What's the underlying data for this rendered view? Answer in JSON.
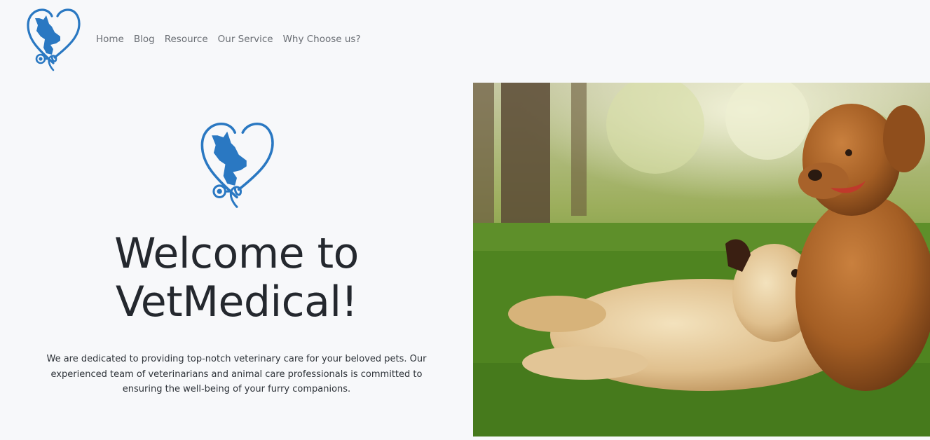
{
  "nav": {
    "logo_icon": "vet-heart-stethoscope-logo",
    "links": [
      {
        "label": "Home"
      },
      {
        "label": "Blog"
      },
      {
        "label": "Resource"
      },
      {
        "label": "Our Service"
      },
      {
        "label": "Why Choose us?"
      }
    ]
  },
  "hero": {
    "logo_icon": "vet-heart-stethoscope-logo",
    "title_line1": "Welcome to",
    "title_line2": "VetMedical!",
    "description": "We are dedicated to providing top-notch veterinary care for your beloved pets. Our experienced team of veterinarians and animal care professionals is committed to ensuring the well-being of your furry companions.",
    "image_icon": "two-golden-retrievers-on-grass-photo"
  },
  "colors": {
    "background": "#f7f8fa",
    "brand_blue": "#2a78c2",
    "nav_text": "#6b6f75",
    "title_text": "#24282e"
  }
}
